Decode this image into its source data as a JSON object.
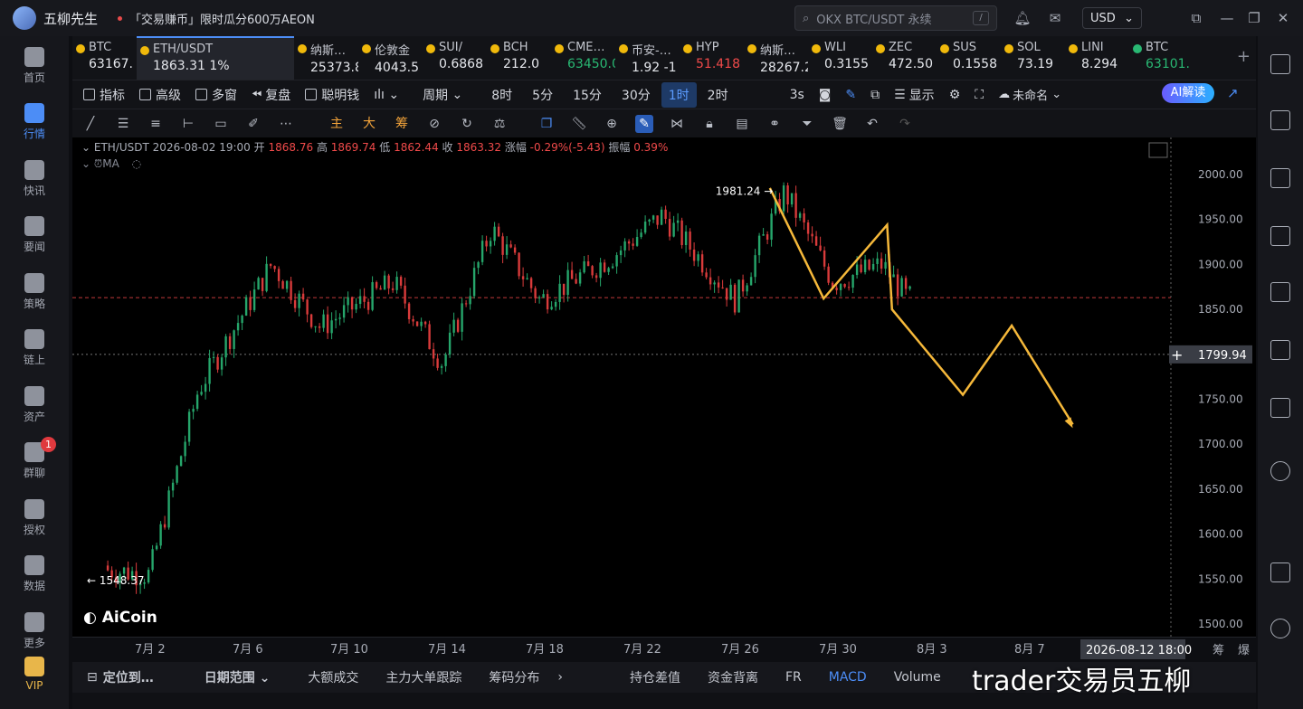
{
  "titlebar": {
    "app_name": "五柳先生",
    "promo": "「交易赚币」限时瓜分600万AEON",
    "search_placeholder": "OKX BTC/USDT 永续",
    "search_hint": "/",
    "currency": "USD"
  },
  "nav": [
    {
      "label": "首页"
    },
    {
      "label": "行情"
    },
    {
      "label": "快讯"
    },
    {
      "label": "要闻"
    },
    {
      "label": "策略"
    },
    {
      "label": "链上"
    },
    {
      "label": "资产"
    },
    {
      "label": "群聊",
      "badge": "1"
    },
    {
      "label": "授权"
    },
    {
      "label": "数据"
    },
    {
      "label": "更多"
    },
    {
      "label": "VIP"
    }
  ],
  "tickers": [
    {
      "sym": "BTC",
      "px": "63167.",
      "color": "w"
    },
    {
      "sym": "ETH/USDT",
      "px": "1863.31  1%",
      "color": "w"
    },
    {
      "sym": "纳斯…",
      "px": "25373.8",
      "color": "w"
    },
    {
      "sym": "伦敦金",
      "px": "4043.5",
      "color": "w"
    },
    {
      "sym": "SUI/",
      "px": "0.6868",
      "color": "w"
    },
    {
      "sym": "BCH",
      "px": "212.0",
      "color": "w"
    },
    {
      "sym": "CME…",
      "px": "63450.0",
      "color": "g"
    },
    {
      "sym": "币安-…",
      "px": "1.92  -1",
      "color": "w"
    },
    {
      "sym": "HYP",
      "px": "51.418",
      "color": "r"
    },
    {
      "sym": "纳斯…",
      "px": "28267.2",
      "color": "w"
    },
    {
      "sym": "WLI",
      "px": "0.3155",
      "color": "w"
    },
    {
      "sym": "ZEC",
      "px": "472.50",
      "color": "w"
    },
    {
      "sym": "SUS",
      "px": "0.1558",
      "color": "w"
    },
    {
      "sym": "SOL",
      "px": "73.19",
      "color": "w"
    },
    {
      "sym": "LINI",
      "px": "8.294",
      "color": "w"
    },
    {
      "sym": "BTC",
      "px": "63101.",
      "color": "g"
    }
  ],
  "toolbar1": {
    "indicator": "指标",
    "advanced": "高级",
    "multi": "多窗",
    "replay": "复盘",
    "smart_money": "聪明钱",
    "period": "周期",
    "p8h": "8时",
    "p5m": "5分",
    "p15m": "15分",
    "p30m": "30分",
    "p1h": "1时",
    "p2h": "2时",
    "p3s": "3s",
    "display": "显示",
    "unnamed": "未命名",
    "ai": "AI解读"
  },
  "toolbar2": {
    "main": "主",
    "big": "大",
    "chip": "筹"
  },
  "ohlc": {
    "pair": "ETH/USDT",
    "time": "2026-08-02 19:00",
    "open_l": "开",
    "open": "1868.76",
    "high_l": "高",
    "high": "1869.74",
    "low_l": "低",
    "low": "1862.44",
    "close_l": "收",
    "close": "1863.32",
    "chg_l": "涨幅",
    "chg": "-0.29%(-5.43)",
    "amp_l": "振幅",
    "amp": "0.39%",
    "ma": "MA"
  },
  "chart_data": {
    "type": "candlestick",
    "yticks": [
      1500,
      1550,
      1600,
      1650,
      1700,
      1750,
      1800,
      1850,
      1900,
      1950,
      2000
    ],
    "ylabels": [
      "1500.00",
      "1550.00",
      "1600.00",
      "1650.00",
      "1700.00",
      "1750.00",
      "1800.00",
      "1850.00",
      "1900.00",
      "1950.00",
      "2000.00"
    ],
    "xlabels": [
      "7月 2",
      "7月 6",
      "7月 10",
      "7月 14",
      "7月 18",
      "7月 22",
      "7月 26",
      "7月 30",
      "8月 3",
      "8月 7"
    ],
    "crosshair_price": "1799.94",
    "crosshair_time": "2026-08-12 18:00",
    "current_price_line": 1863,
    "high_label": "1981.24",
    "low_label": "1548.37",
    "trend_path": [
      {
        "x": "7月 4",
        "y": 1760
      },
      {
        "x": "7月 7",
        "y": 1900
      },
      {
        "x": "7月 9",
        "y": 1830
      },
      {
        "x": "7月 12",
        "y": 1880
      },
      {
        "x": "7月 14",
        "y": 1790
      },
      {
        "x": "7月 16",
        "y": 1940
      },
      {
        "x": "7月 18",
        "y": 1860
      },
      {
        "x": "7月 21",
        "y": 1910
      },
      {
        "x": "7月 23",
        "y": 1955
      },
      {
        "x": "7月 26",
        "y": 1860
      },
      {
        "x": "7月 28",
        "y": 1981
      },
      {
        "x": "7月 30",
        "y": 1880
      },
      {
        "x": "8月 1",
        "y": 1900
      },
      {
        "x": "8月 2",
        "y": 1863
      }
    ],
    "projection": [
      1985,
      1862,
      1944,
      1850,
      1755,
      1832,
      1722
    ],
    "logo": "AiCoin"
  },
  "bottombar": {
    "locate": "定位到…",
    "date_range": "日期范围",
    "big_trade": "大额成交",
    "big_order": "主力大单跟踪",
    "chip_dist": "筹码分布",
    "oi_diff": "持仓差值",
    "funding": "资金背离",
    "fr": "FR",
    "macd": "MACD",
    "volume": "Volume"
  },
  "x_right": {
    "a": "筹",
    "b": "爆"
  },
  "watermark": "trader交易员五柳"
}
